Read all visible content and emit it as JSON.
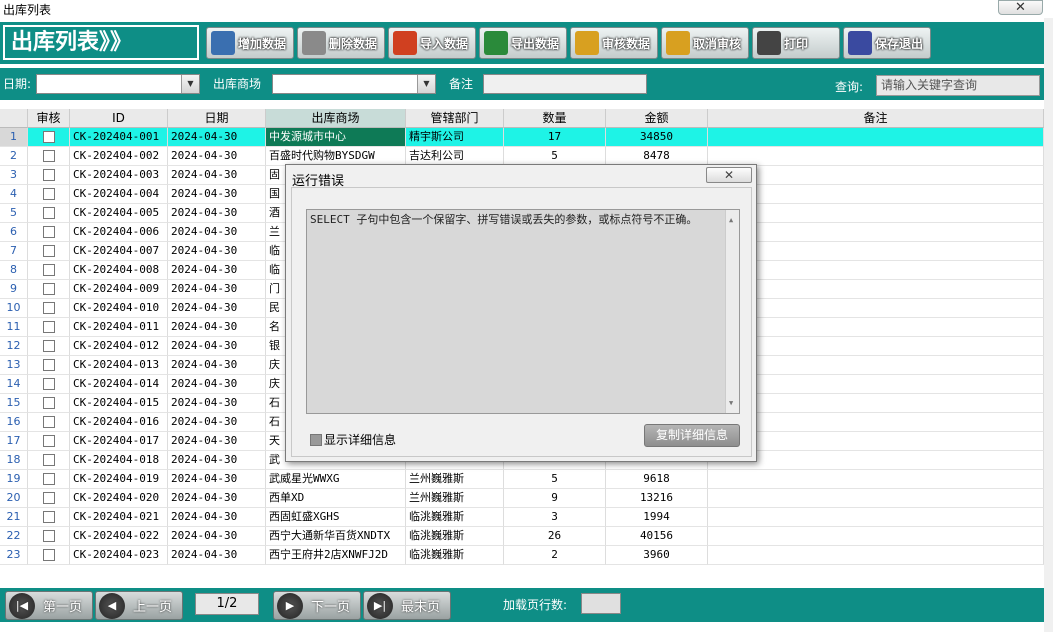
{
  "window": {
    "title": "出库列表",
    "close_glyph": "✕"
  },
  "toolbar": {
    "app_title": "出库列表》》",
    "buttons": [
      {
        "label": "增加数据",
        "icon": "add-doc-icon",
        "color": "#3a6fb0"
      },
      {
        "label": "删除数据",
        "icon": "trash-icon",
        "color": "#8a8a8a"
      },
      {
        "label": "导入数据",
        "icon": "import-chart-icon",
        "color": "#d04020"
      },
      {
        "label": "导出数据",
        "icon": "export-excel-icon",
        "color": "#2a8a3a"
      },
      {
        "label": "审核数据",
        "icon": "key-approve-icon",
        "color": "#d8a020"
      },
      {
        "label": "取消审核",
        "icon": "key-cancel-icon",
        "color": "#d8a020"
      },
      {
        "label": "打印",
        "icon": "printer-icon",
        "color": "#444444"
      },
      {
        "label": "保存退出",
        "icon": "save-disk-icon",
        "color": "#3a4aa0"
      }
    ]
  },
  "filters": {
    "date_label": "日期:",
    "mall_label": "出库商场",
    "note_label": "备注",
    "query_label": "查询:",
    "search_placeholder": "请输入关键字查询"
  },
  "table": {
    "columns": [
      "审核",
      "ID",
      "日期",
      "出库商场",
      "管辖部门",
      "数量",
      "金额",
      "备注"
    ],
    "rows": [
      {
        "n": "1",
        "id": "CK-202404-001",
        "date": "2024-04-30",
        "mall": "中发源城市中心",
        "dept": "精宇斯公司",
        "qty": "17",
        "amt": "34850"
      },
      {
        "n": "2",
        "id": "CK-202404-002",
        "date": "2024-04-30",
        "mall": "百盛时代购物BYSDGW",
        "dept": "吉达利公司",
        "qty": "5",
        "amt": "8478"
      },
      {
        "n": "3",
        "id": "CK-202404-003",
        "date": "2024-04-30",
        "mall": "固",
        "dept": "",
        "qty": "",
        "amt": ""
      },
      {
        "n": "4",
        "id": "CK-202404-004",
        "date": "2024-04-30",
        "mall": "国",
        "dept": "",
        "qty": "",
        "amt": ""
      },
      {
        "n": "5",
        "id": "CK-202404-005",
        "date": "2024-04-30",
        "mall": "酒",
        "dept": "",
        "qty": "",
        "amt": ""
      },
      {
        "n": "6",
        "id": "CK-202404-006",
        "date": "2024-04-30",
        "mall": "兰",
        "dept": "",
        "qty": "",
        "amt": ""
      },
      {
        "n": "7",
        "id": "CK-202404-007",
        "date": "2024-04-30",
        "mall": "临",
        "dept": "",
        "qty": "",
        "amt": ""
      },
      {
        "n": "8",
        "id": "CK-202404-008",
        "date": "2024-04-30",
        "mall": "临",
        "dept": "",
        "qty": "",
        "amt": ""
      },
      {
        "n": "9",
        "id": "CK-202404-009",
        "date": "2024-04-30",
        "mall": "门",
        "dept": "",
        "qty": "",
        "amt": ""
      },
      {
        "n": "10",
        "id": "CK-202404-010",
        "date": "2024-04-30",
        "mall": "民",
        "dept": "",
        "qty": "",
        "amt": ""
      },
      {
        "n": "11",
        "id": "CK-202404-011",
        "date": "2024-04-30",
        "mall": "名",
        "dept": "",
        "qty": "",
        "amt": ""
      },
      {
        "n": "12",
        "id": "CK-202404-012",
        "date": "2024-04-30",
        "mall": "银",
        "dept": "",
        "qty": "",
        "amt": ""
      },
      {
        "n": "13",
        "id": "CK-202404-013",
        "date": "2024-04-30",
        "mall": "庆",
        "dept": "",
        "qty": "",
        "amt": ""
      },
      {
        "n": "14",
        "id": "CK-202404-014",
        "date": "2024-04-30",
        "mall": "庆",
        "dept": "",
        "qty": "",
        "amt": ""
      },
      {
        "n": "15",
        "id": "CK-202404-015",
        "date": "2024-04-30",
        "mall": "石",
        "dept": "",
        "qty": "",
        "amt": ""
      },
      {
        "n": "16",
        "id": "CK-202404-016",
        "date": "2024-04-30",
        "mall": "石",
        "dept": "",
        "qty": "",
        "amt": ""
      },
      {
        "n": "17",
        "id": "CK-202404-017",
        "date": "2024-04-30",
        "mall": "天",
        "dept": "",
        "qty": "",
        "amt": ""
      },
      {
        "n": "18",
        "id": "CK-202404-018",
        "date": "2024-04-30",
        "mall": "武",
        "dept": "",
        "qty": "",
        "amt": ""
      },
      {
        "n": "19",
        "id": "CK-202404-019",
        "date": "2024-04-30",
        "mall": "武威星光WWXG",
        "dept": "兰州巍雅斯",
        "qty": "5",
        "amt": "9618"
      },
      {
        "n": "20",
        "id": "CK-202404-020",
        "date": "2024-04-30",
        "mall": "西单XD",
        "dept": "兰州巍雅斯",
        "qty": "9",
        "amt": "13216"
      },
      {
        "n": "21",
        "id": "CK-202404-021",
        "date": "2024-04-30",
        "mall": "西固虹盛XGHS",
        "dept": "临洮巍雅斯",
        "qty": "3",
        "amt": "1994"
      },
      {
        "n": "22",
        "id": "CK-202404-022",
        "date": "2024-04-30",
        "mall": "西宁大通新华百货XNDTX",
        "dept": "临洮巍雅斯",
        "qty": "26",
        "amt": "40156"
      },
      {
        "n": "23",
        "id": "CK-202404-023",
        "date": "2024-04-30",
        "mall": "西宁王府井2店XNWFJ2D",
        "dept": "临洮巍雅斯",
        "qty": "2",
        "amt": "3960"
      }
    ]
  },
  "dialog": {
    "title": "运行错误",
    "close_glyph": "✕",
    "message": "SELECT 子句中包含一个保留字、拼写错误或丢失的参数，或标点符号不正确。",
    "show_details_label": "显示详细信息",
    "copy_button_label": "复制详细信息"
  },
  "pager": {
    "first_label": "第一页",
    "prev_label": "上一页",
    "page_text": "1/2",
    "next_label": "下一页",
    "last_label": "最末页",
    "rows_label": "加载页行数:"
  },
  "colors": {
    "teal": "#0e8e86",
    "selected_row": "#1ef3e6",
    "selected_cell": "#0e7a56"
  }
}
